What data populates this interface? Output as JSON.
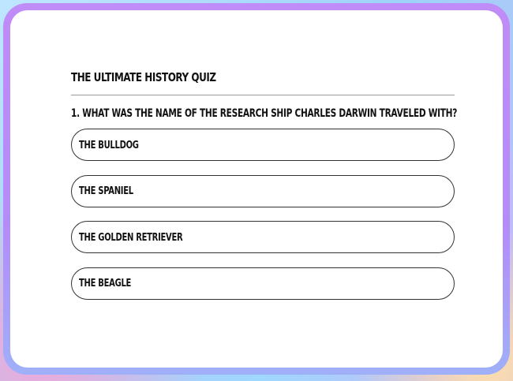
{
  "quiz": {
    "title": "THE ULTIMATE HISTORY QUIZ",
    "question": "1. WHAT WAS THE NAME OF THE RESEARCH SHIP CHARLES DARWIN TRAVELED WITH?",
    "options": [
      {
        "label": "THE BULLDOG"
      },
      {
        "label": "THE SPANIEL"
      },
      {
        "label": "THE GOLDEN RETRIEVER"
      },
      {
        "label": "THE BEAGLE"
      }
    ]
  },
  "colors": {
    "frame": "#b48cf8",
    "card": "#ffffff",
    "text": "#111111",
    "divider": "#9a9a9a"
  }
}
